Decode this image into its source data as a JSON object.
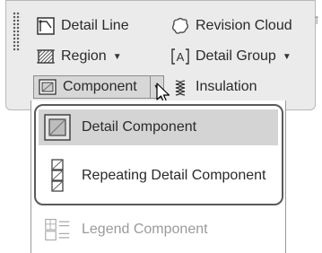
{
  "ribbon": {
    "detail_line": "Detail Line",
    "revision_cloud": "Revision Cloud",
    "region": "Region",
    "detail_group": "Detail Group",
    "component": "Component",
    "insulation": "Insulation"
  },
  "menu": {
    "items": [
      {
        "label": "Detail Component",
        "icon": "detail-component-icon",
        "state": "highlighted"
      },
      {
        "label": "Repeating Detail Component",
        "icon": "repeating-detail-icon",
        "state": "normal"
      },
      {
        "label": "Legend Component",
        "icon": "legend-component-icon",
        "state": "disabled"
      }
    ]
  },
  "colors": {
    "panel": "#ebebeb",
    "highlight": "#d4d4d4",
    "disabled_text": "#9a9a9a"
  }
}
